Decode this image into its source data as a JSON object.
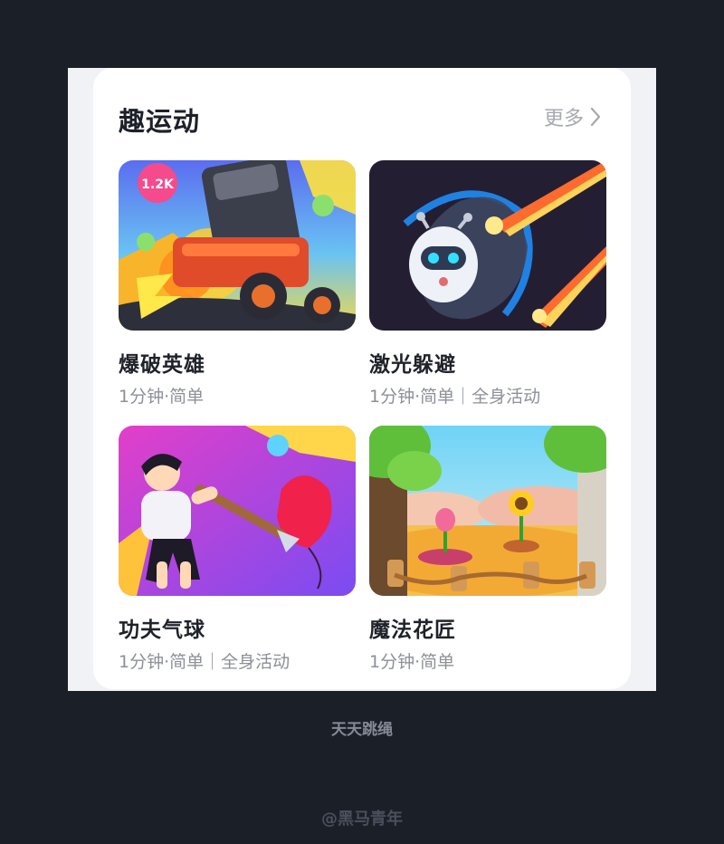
{
  "section": {
    "title": "趣运动",
    "more_label": "更多"
  },
  "games": [
    {
      "name": "爆破英雄",
      "meta": "1分钟·简单",
      "badge": "1.2K",
      "icon": "cannon-game-thumbnail"
    },
    {
      "name": "激光躲避",
      "meta": "1分钟·简单｜全身活动",
      "icon": "robot-laser-game-thumbnail"
    },
    {
      "name": "功夫气球",
      "meta": "1分钟·简单｜全身活动",
      "icon": "kungfu-balloon-game-thumbnail"
    },
    {
      "name": "魔法花匠",
      "meta": "1分钟·简单",
      "icon": "magic-garden-game-thumbnail"
    }
  ],
  "caption": "天天跳绳",
  "watermark": "@黑马青年",
  "colors": {
    "background": "#1b1f27",
    "card": "#ffffff",
    "title": "#1d2029",
    "secondary_text": "#8d9098",
    "more": "#a6a9b1"
  }
}
